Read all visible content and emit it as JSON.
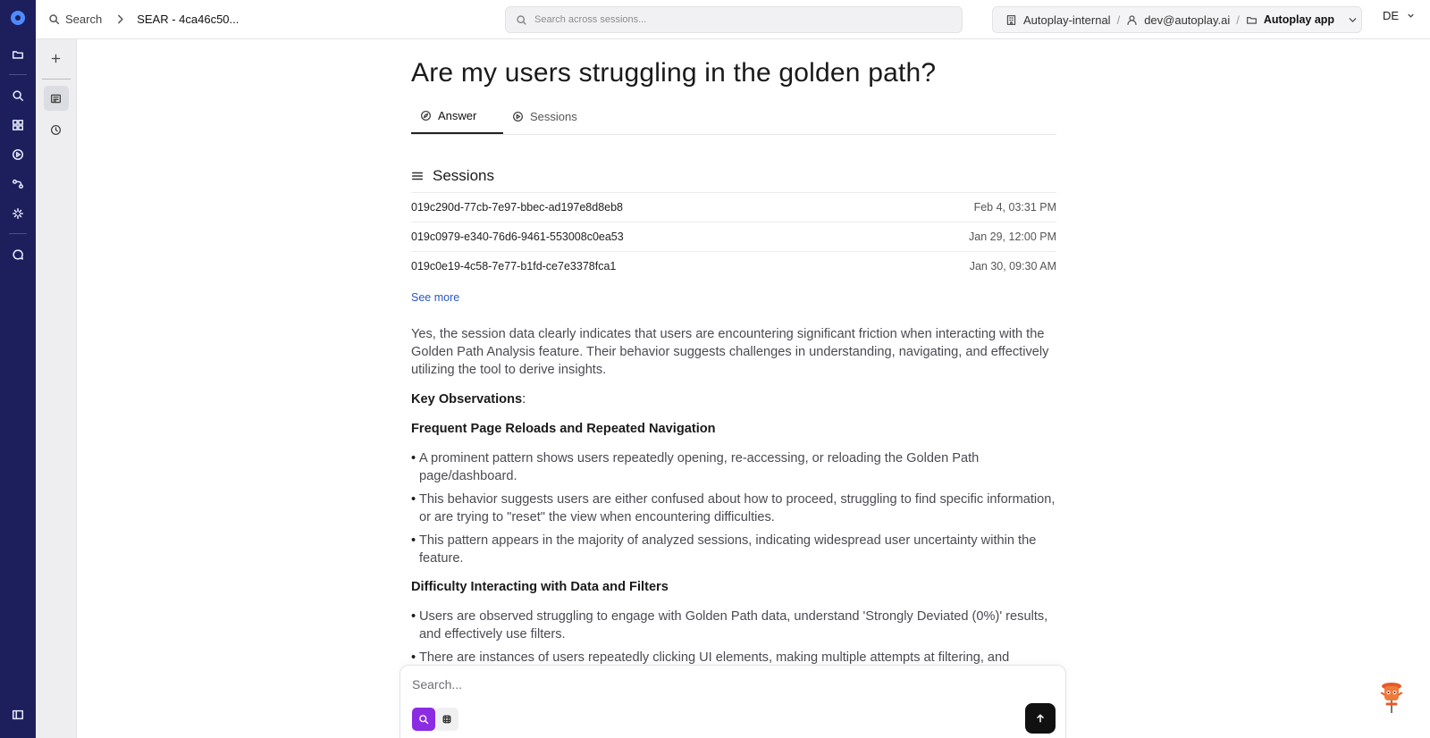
{
  "topbar": {
    "search_label": "Search",
    "crumb_title": "SEAR - 4ca46c50...",
    "global_search_placeholder": "Search across sessions...",
    "org": "Autoplay-internal",
    "user": "dev@autoplay.ai",
    "app": "Autoplay app",
    "avatar_initials": "DE"
  },
  "rail_icons": [
    "logo-icon",
    "folder-icon",
    "search-icon",
    "dashboard-icon",
    "play-circle-icon",
    "flow-icon",
    "sparkle-icon",
    "chat-icon",
    "sidebar-toggle-icon"
  ],
  "page": {
    "title": "Are my users struggling in the golden path?",
    "tabs": [
      {
        "label": "Answer",
        "icon": "compass-icon",
        "active": true
      },
      {
        "label": "Sessions",
        "icon": "play-circle-icon",
        "active": false
      }
    ]
  },
  "sessions": {
    "heading": "Sessions",
    "rows": [
      {
        "id": "019c290d-77cb-7e97-bbec-ad197e8d8eb8",
        "time": "Feb 4, 03:31 PM"
      },
      {
        "id": "019c0979-e340-76d6-9461-553008c0ea53",
        "time": "Jan 29, 12:00 PM"
      },
      {
        "id": "019c0e19-4c58-7e77-b1fd-ce7e3378fca1",
        "time": "Jan 30, 09:30 AM"
      }
    ],
    "see_more": "See more"
  },
  "answer": {
    "intro": "Yes, the session data clearly indicates that users are encountering significant friction when interacting with the Golden Path Analysis feature. Their behavior suggests challenges in understanding, navigating, and effectively utilizing the tool to derive insights.",
    "key_obs": "Key Observations",
    "key_obs_colon": ":",
    "sections": [
      {
        "heading": "Frequent Page Reloads and Repeated Navigation",
        "bullets": [
          "A prominent pattern shows users repeatedly opening, re-accessing, or reloading the Golden Path page/dashboard.",
          "This behavior suggests users are either confused about how to proceed, struggling to find specific information, or are trying to \"reset\" the view when encountering difficulties.",
          "This pattern appears in the majority of analyzed sessions, indicating widespread user uncertainty within the feature."
        ]
      },
      {
        "heading": "Difficulty Interacting with Data and Filters",
        "bullets": [
          "Users are observed struggling to engage with Golden Path data, understand 'Strongly Deviated (0%)' results, and effectively use filters.",
          "There are instances of users repeatedly clicking UI elements, making multiple attempts at filtering, and"
        ]
      }
    ]
  },
  "chat": {
    "placeholder": "Search..."
  },
  "colors": {
    "rail": "#1c1f5c",
    "accent_purple": "#8b2be2",
    "link_blue": "#2857c5",
    "send": "#111111"
  }
}
